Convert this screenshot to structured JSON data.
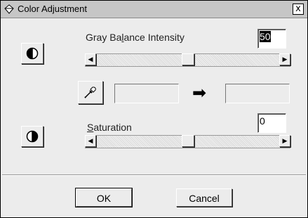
{
  "window": {
    "title": "Color Adjustment",
    "close_label": "x"
  },
  "gray_balance": {
    "label_prefix": "Gray Ba",
    "label_accel": "l",
    "label_suffix": "ance Intensity",
    "value": "50",
    "slider_level": 0.5
  },
  "saturation": {
    "label_accel": "S",
    "label_rest": "aturation",
    "value": "0",
    "slider_level": 0.5
  },
  "scroll": {
    "left_arrow": "◀",
    "right_arrow": "▶"
  },
  "arrow_glyph": "➡",
  "buttons": {
    "ok": "OK",
    "cancel": "Cancel"
  }
}
